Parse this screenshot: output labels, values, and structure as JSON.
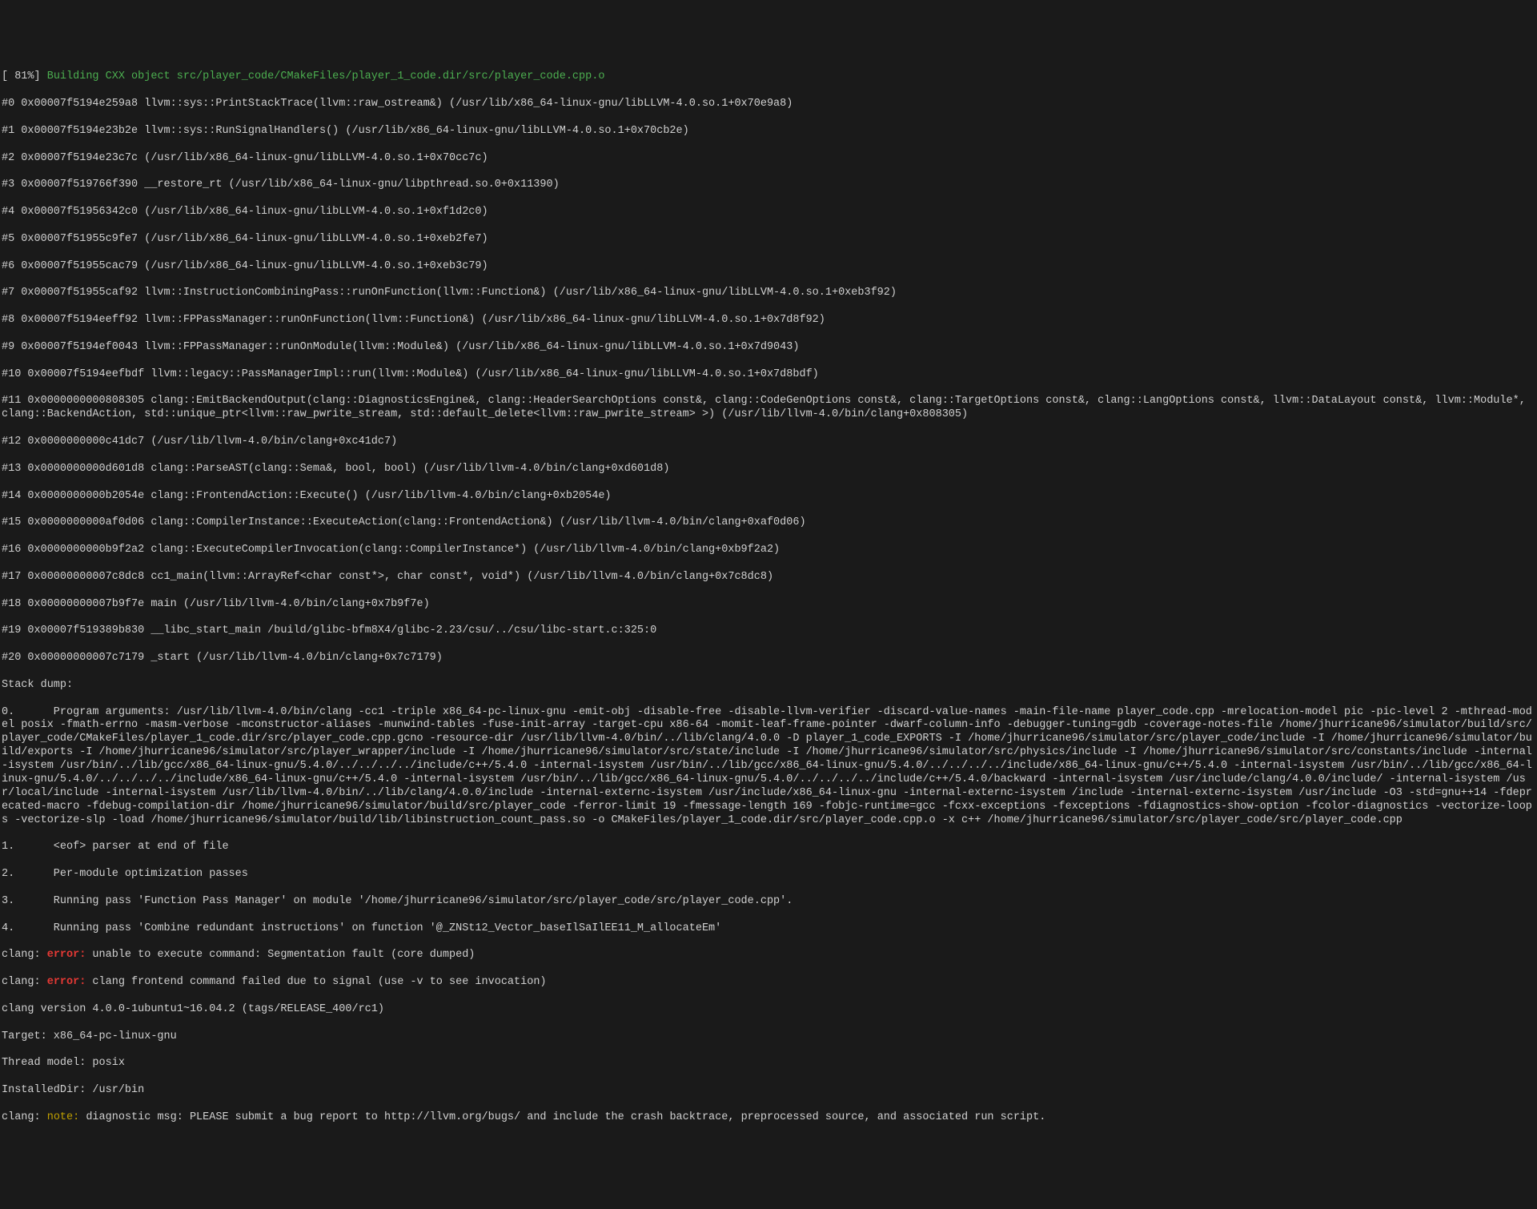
{
  "build_progress": "[ 81%] ",
  "build_status": "Building CXX object src/player_code/CMakeFiles/player_1_code.dir/src/player_code.cpp.o",
  "stack_frames": [
    "#0 0x00007f5194e259a8 llvm::sys::PrintStackTrace(llvm::raw_ostream&) (/usr/lib/x86_64-linux-gnu/libLLVM-4.0.so.1+0x70e9a8)",
    "#1 0x00007f5194e23b2e llvm::sys::RunSignalHandlers() (/usr/lib/x86_64-linux-gnu/libLLVM-4.0.so.1+0x70cb2e)",
    "#2 0x00007f5194e23c7c (/usr/lib/x86_64-linux-gnu/libLLVM-4.0.so.1+0x70cc7c)",
    "#3 0x00007f519766f390 __restore_rt (/usr/lib/x86_64-linux-gnu/libpthread.so.0+0x11390)",
    "#4 0x00007f51956342c0 (/usr/lib/x86_64-linux-gnu/libLLVM-4.0.so.1+0xf1d2c0)",
    "#5 0x00007f51955c9fe7 (/usr/lib/x86_64-linux-gnu/libLLVM-4.0.so.1+0xeb2fe7)",
    "#6 0x00007f51955cac79 (/usr/lib/x86_64-linux-gnu/libLLVM-4.0.so.1+0xeb3c79)",
    "#7 0x00007f51955caf92 llvm::InstructionCombiningPass::runOnFunction(llvm::Function&) (/usr/lib/x86_64-linux-gnu/libLLVM-4.0.so.1+0xeb3f92)",
    "#8 0x00007f5194eeff92 llvm::FPPassManager::runOnFunction(llvm::Function&) (/usr/lib/x86_64-linux-gnu/libLLVM-4.0.so.1+0x7d8f92)",
    "#9 0x00007f5194ef0043 llvm::FPPassManager::runOnModule(llvm::Module&) (/usr/lib/x86_64-linux-gnu/libLLVM-4.0.so.1+0x7d9043)",
    "#10 0x00007f5194eefbdf llvm::legacy::PassManagerImpl::run(llvm::Module&) (/usr/lib/x86_64-linux-gnu/libLLVM-4.0.so.1+0x7d8bdf)",
    "#11 0x0000000000808305 clang::EmitBackendOutput(clang::DiagnosticsEngine&, clang::HeaderSearchOptions const&, clang::CodeGenOptions const&, clang::TargetOptions const&, clang::LangOptions const&, llvm::DataLayout const&, llvm::Module*, clang::BackendAction, std::unique_ptr<llvm::raw_pwrite_stream, std::default_delete<llvm::raw_pwrite_stream> >) (/usr/lib/llvm-4.0/bin/clang+0x808305)",
    "#12 0x0000000000c41dc7 (/usr/lib/llvm-4.0/bin/clang+0xc41dc7)",
    "#13 0x0000000000d601d8 clang::ParseAST(clang::Sema&, bool, bool) (/usr/lib/llvm-4.0/bin/clang+0xd601d8)",
    "#14 0x0000000000b2054e clang::FrontendAction::Execute() (/usr/lib/llvm-4.0/bin/clang+0xb2054e)",
    "#15 0x0000000000af0d06 clang::CompilerInstance::ExecuteAction(clang::FrontendAction&) (/usr/lib/llvm-4.0/bin/clang+0xaf0d06)",
    "#16 0x0000000000b9f2a2 clang::ExecuteCompilerInvocation(clang::CompilerInstance*) (/usr/lib/llvm-4.0/bin/clang+0xb9f2a2)",
    "#17 0x00000000007c8dc8 cc1_main(llvm::ArrayRef<char const*>, char const*, void*) (/usr/lib/llvm-4.0/bin/clang+0x7c8dc8)",
    "#18 0x00000000007b9f7e main (/usr/lib/llvm-4.0/bin/clang+0x7b9f7e)",
    "#19 0x00007f519389b830 __libc_start_main /build/glibc-bfm8X4/glibc-2.23/csu/../csu/libc-start.c:325:0",
    "#20 0x00000000007c7179 _start (/usr/lib/llvm-4.0/bin/clang+0x7c7179)"
  ],
  "stack_dump_header": "Stack dump:",
  "dump_lines": [
    "0.      Program arguments: /usr/lib/llvm-4.0/bin/clang -cc1 -triple x86_64-pc-linux-gnu -emit-obj -disable-free -disable-llvm-verifier -discard-value-names -main-file-name player_code.cpp -mrelocation-model pic -pic-level 2 -mthread-model posix -fmath-errno -masm-verbose -mconstructor-aliases -munwind-tables -fuse-init-array -target-cpu x86-64 -momit-leaf-frame-pointer -dwarf-column-info -debugger-tuning=gdb -coverage-notes-file /home/jhurricane96/simulator/build/src/player_code/CMakeFiles/player_1_code.dir/src/player_code.cpp.gcno -resource-dir /usr/lib/llvm-4.0/bin/../lib/clang/4.0.0 -D player_1_code_EXPORTS -I /home/jhurricane96/simulator/src/player_code/include -I /home/jhurricane96/simulator/build/exports -I /home/jhurricane96/simulator/src/player_wrapper/include -I /home/jhurricane96/simulator/src/state/include -I /home/jhurricane96/simulator/src/physics/include -I /home/jhurricane96/simulator/src/constants/include -internal-isystem /usr/bin/../lib/gcc/x86_64-linux-gnu/5.4.0/../../../../include/c++/5.4.0 -internal-isystem /usr/bin/../lib/gcc/x86_64-linux-gnu/5.4.0/../../../../include/x86_64-linux-gnu/c++/5.4.0 -internal-isystem /usr/bin/../lib/gcc/x86_64-linux-gnu/5.4.0/../../../../include/x86_64-linux-gnu/c++/5.4.0 -internal-isystem /usr/bin/../lib/gcc/x86_64-linux-gnu/5.4.0/../../../../include/c++/5.4.0/backward -internal-isystem /usr/include/clang/4.0.0/include/ -internal-isystem /usr/local/include -internal-isystem /usr/lib/llvm-4.0/bin/../lib/clang/4.0.0/include -internal-externc-isystem /usr/include/x86_64-linux-gnu -internal-externc-isystem /include -internal-externc-isystem /usr/include -O3 -std=gnu++14 -fdeprecated-macro -fdebug-compilation-dir /home/jhurricane96/simulator/build/src/player_code -ferror-limit 19 -fmessage-length 169 -fobjc-runtime=gcc -fcxx-exceptions -fexceptions -fdiagnostics-show-option -fcolor-diagnostics -vectorize-loops -vectorize-slp -load /home/jhurricane96/simulator/build/lib/libinstruction_count_pass.so -o CMakeFiles/player_1_code.dir/src/player_code.cpp.o -x c++ /home/jhurricane96/simulator/src/player_code/src/player_code.cpp",
    "1.      <eof> parser at end of file",
    "2.      Per-module optimization passes",
    "3.      Running pass 'Function Pass Manager' on module '/home/jhurricane96/simulator/src/player_code/src/player_code.cpp'.",
    "4.      Running pass 'Combine redundant instructions' on function '@_ZNSt12_Vector_baseIlSaIlEE11_M_allocateEm'"
  ],
  "error1_prefix": "clang: ",
  "error1_tag": "error:",
  "error1_text": " unable to execute command: Segmentation fault (core dumped)",
  "error2_prefix": "clang: ",
  "error2_tag": "error:",
  "error2_text": " clang frontend command failed due to signal (use -v to see invocation)",
  "version_line": "clang version 4.0.0-1ubuntu1~16.04.2 (tags/RELEASE_400/rc1)",
  "target_line": "Target: x86_64-pc-linux-gnu",
  "thread_model_line": "Thread model: posix",
  "installed_dir_line": "InstalledDir: /usr/bin",
  "note_prefix": "clang: ",
  "note_tag": "note:",
  "note_text": " diagnostic msg: PLEASE submit a bug report to http://llvm.org/bugs/ and include the crash backtrace, preprocessed source, and associated run script."
}
